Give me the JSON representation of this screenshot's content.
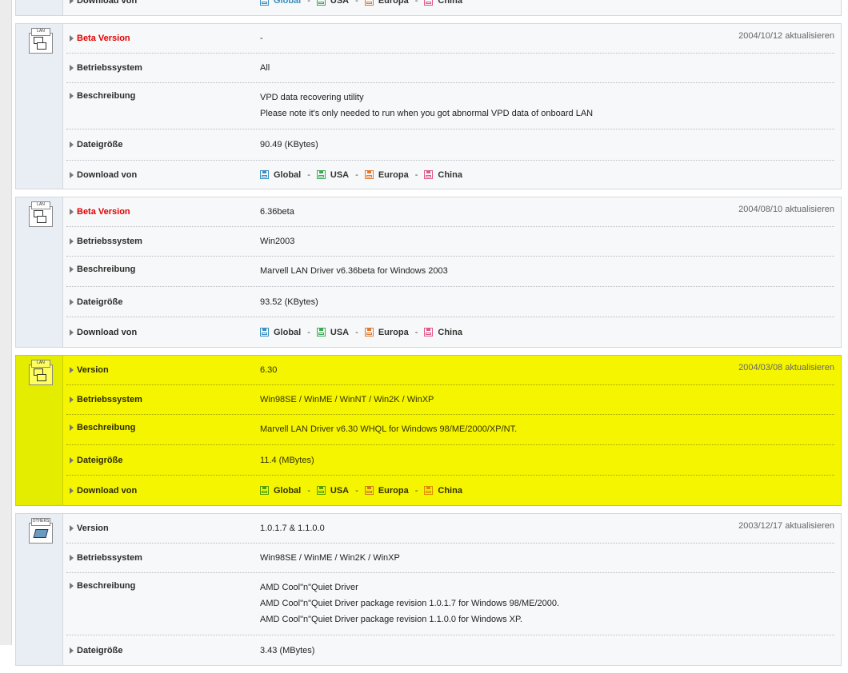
{
  "labels": {
    "beta": "Beta Version",
    "version": "Version",
    "os": "Betriebssystem",
    "desc": "Beschreibung",
    "size": "Dateigröße",
    "download": "Download von"
  },
  "mirrors": {
    "global": "Global",
    "usa": "USA",
    "europa": "Europa",
    "china": "China"
  },
  "separator": "-",
  "entries": [
    {
      "icon_text": "LAN",
      "version": "-",
      "date": "2004/10/12 aktualisieren",
      "os": "All",
      "desc1": "VPD data recovering utility",
      "desc2": "Please note it's only needed to run when you got abnormal VPD data of onboard LAN",
      "size": "90.49 (KBytes)"
    },
    {
      "icon_text": "LAN",
      "version": "6.36beta",
      "date": "2004/08/10 aktualisieren",
      "os": "Win2003",
      "desc1": "Marvell LAN Driver v6.36beta for Windows 2003",
      "size": "93.52 (KBytes)"
    },
    {
      "icon_text": "LAN",
      "version": "6.30",
      "date": "2004/03/08 aktualisieren",
      "os": "Win98SE / WinME / WinNT / Win2K / WinXP",
      "desc1": "Marvell LAN Driver v6.30 WHQL for Windows 98/ME/2000/XP/NT.",
      "size": "11.4 (MBytes)"
    },
    {
      "icon_text": "OTHERS",
      "version": "1.0.1.7 & 1.1.0.0",
      "date": "2003/12/17 aktualisieren",
      "os": "Win98SE / WinME / Win2K / WinXP",
      "desc1": "AMD Cool\"n\"Quiet Driver",
      "desc2": "AMD Cool\"n\"Quiet Driver package revision 1.0.1.7 for Windows 98/ME/2000.",
      "desc3": "AMD Cool\"n\"Quiet Driver package revision 1.1.0.0 for Windows XP.",
      "size": "3.43 (MBytes)"
    }
  ]
}
